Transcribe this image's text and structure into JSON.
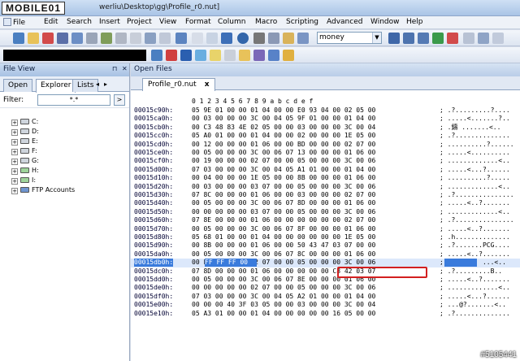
{
  "logo": "MOBILE01",
  "window_title": "werliu\\Desktop\\gg\\Profile_r0.nut]",
  "menu": [
    "File",
    "Edit",
    "Search",
    "Insert",
    "Project",
    "View",
    "Format",
    "Column",
    "Macro",
    "Scripting",
    "Advanced",
    "Window",
    "Help"
  ],
  "toolbar": {
    "search_value": "money"
  },
  "file_view": {
    "title": "File View",
    "tabs": [
      "Open",
      "Explorer",
      "Lists"
    ],
    "active_tab": "Explorer",
    "filter_label": "Filter:",
    "filter_value": "*.*",
    "filter_button": ">",
    "tree": [
      "C:",
      "D:",
      "E:",
      "F:",
      "G:",
      "H:",
      "I:",
      "FTP Accounts"
    ]
  },
  "editor": {
    "panel_title": "Open Files",
    "tab_label": "Profile_r0.nut",
    "tab_close": "x",
    "columns": "0  1  2  3  4  5  6  7  8  9  a  b  c  d  e  f",
    "rows": [
      {
        "addr": "00015c90h:",
        "bytes": "05 9E 01 00 00 01 04 00 00 E0 93 04 00 02 05 00",
        "asc": "; .?.........?...."
      },
      {
        "addr": "00015ca0h:",
        "bytes": "00 03 00 00 00 3C 00 04 05 9F 01 00 00 01 04 00",
        "asc": "; .....<.......?.."
      },
      {
        "addr": "00015cb0h:",
        "bytes": "00 C3 48 83 4E 02 05 00 00 03 00 00 00 3C 00 04",
        "asc": "; .鑄 .......<.."
      },
      {
        "addr": "00015cc0h:",
        "bytes": "05 A0 01 00 00 01 04 00 00 02 00 00 00 1E 05 00",
        "asc": "; .?.............."
      },
      {
        "addr": "00015cd0h:",
        "bytes": "00 12 00 00 00 01 06 00 00 BD 00 00 00 02 07 00",
        "asc": "; ..........?......"
      },
      {
        "addr": "00015ce0h:",
        "bytes": "00 05 00 00 00 3C 00 06 07 13 00 00 00 01 06 00",
        "asc": "; .....<.........."
      },
      {
        "addr": "00015cf0h:",
        "bytes": "00 19 00 00 00 02 07 00 00 05 00 00 00 3C 00 06",
        "asc": "; .............<.."
      },
      {
        "addr": "00015d00h:",
        "bytes": "07 03 00 00 00 3C 00 04 05 A1 01 00 00 01 04 00",
        "asc": "; .....<...?......"
      },
      {
        "addr": "00015d10h:",
        "bytes": "00 04 00 00 00 1E 05 00 00 8B 00 00 00 01 06 00",
        "asc": "; ..........?....."
      },
      {
        "addr": "00015d20h:",
        "bytes": "00 03 00 00 00 03 07 00 00 05 00 00 00 3C 00 06",
        "asc": "; .............<.."
      },
      {
        "addr": "00015d30h:",
        "bytes": "07 8C 00 00 00 01 06 00 00 03 00 00 00 02 07 00",
        "asc": "; .?..............."
      },
      {
        "addr": "00015d40h:",
        "bytes": "00 05 00 00 00 3C 00 06 07 8D 00 00 00 01 06 00",
        "asc": "; .....<..?......."
      },
      {
        "addr": "00015d50h:",
        "bytes": "00 00 00 00 00 03 07 00 00 05 00 00 00 3C 00 06",
        "asc": "; .............<.."
      },
      {
        "addr": "00015d60h:",
        "bytes": "07 8E 00 00 00 01 06 00 00 00 00 00 00 02 07 00",
        "asc": "; .?..............."
      },
      {
        "addr": "00015d70h:",
        "bytes": "00 05 00 00 00 3C 00 06 07 8F 00 00 00 01 06 00",
        "asc": "; .....<..?......."
      },
      {
        "addr": "00015d80h:",
        "bytes": "05 68 01 00 00 01 04 00 00 00 00 00 00 1E 05 00",
        "asc": "; .h.............."
      },
      {
        "addr": "00015d90h:",
        "bytes": "00 8B 00 00 00 01 06 00 00 50 43 47 03 07 00 00",
        "asc": "; .?.......PCG...."
      },
      {
        "addr": "00015da0h:",
        "bytes": "00 05 00 00 00 3C 00 06 07 8C 00 00 00 01 06 00",
        "asc": "; .....<..?......."
      },
      {
        "addr": "00015db0h:",
        "bytes": "00 FF FF FF 00 02 07 00 00 05 00 00 00 3C 00 06",
        "asc": "; .        ...<.."
      },
      {
        "addr": "00015dc0h:",
        "bytes": "07 8D 00 00 00 01 06 00 00 00 00 00 C8 42 03 07",
        "asc": "; .?.........B.."
      },
      {
        "addr": "00015dd0h:",
        "bytes": "00 05 00 00 00 3C 00 06 07 8E 00 00 00 01 06 00",
        "asc": "; .....<..?......."
      },
      {
        "addr": "00015de0h:",
        "bytes": "00 00 00 00 00 02 07 00 00 05 00 00 00 3C 00 06",
        "asc": "; .............<.."
      },
      {
        "addr": "00015df0h:",
        "bytes": "07 03 00 00 00 3C 00 04 05 A2 01 00 00 01 04 00",
        "asc": "; .....<...?......"
      },
      {
        "addr": "00015e00h:",
        "bytes": "00 00 00 40 3F 03 05 00 00 03 00 00 00 3C 00 04",
        "asc": "; ...@?.......<.."
      },
      {
        "addr": "00015e10h:",
        "bytes": "05 A3 01 00 00 01 04 00 00 00 00 00 16 05 00 00",
        "asc": "; .?.............."
      }
    ],
    "selected_row": 18,
    "selected_bytes": "FF FF FF 00"
  },
  "watermark": "#5105441"
}
